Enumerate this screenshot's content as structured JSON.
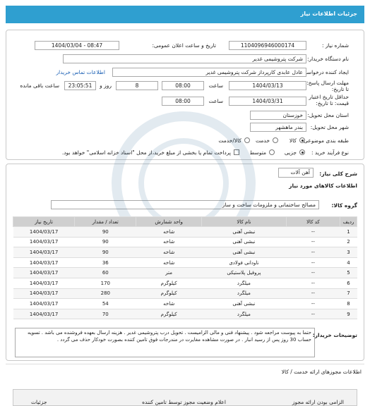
{
  "header": {
    "title": "جزئیات اطلاعات نیاز"
  },
  "form": {
    "need_number_label": "شماره نیاز :",
    "need_number_value": "1104096946000174",
    "announce_label": "تاریخ و ساعت اعلان عمومی:",
    "announce_value": "1404/03/04 - 08:47",
    "buyer_name_label": "نام دستگاه خریدار:",
    "buyer_name_value": "شرکت پتروشیمی غدیر",
    "creator_label": "ایجاد کننده درخواست:",
    "creator_value": "عادل عابدی کارپرداز شرکت پتروشیمی غدیر",
    "contact_link": "اطلاعات تماس خریدار",
    "deadline_label": "مهلت ارسال پاسخ: تا تاریخ:",
    "deadline_date": "1404/03/13",
    "time_label": "ساعت",
    "deadline_time": "08:00",
    "days_value": "8",
    "days_label": "روز و",
    "remaining_time": "23:05:51",
    "remaining_label": "ساعت باقی مانده",
    "validity_label": "حداقل تاریخ اعتبار قیمت: تا تاریخ:",
    "validity_date": "1404/03/31",
    "validity_time": "08:00",
    "province_label": "استان محل تحویل:",
    "province_value": "خوزستان",
    "city_label": "شهر محل تحویل:",
    "city_value": "بندر ماهشهر",
    "category_label": "طبقه بندی موضوعی:",
    "category_options": [
      "کالا",
      "خدمت",
      "کالا/خدمت"
    ],
    "process_label": "نوع فرآیند خرید :",
    "process_options": [
      "جزیی",
      "متوسط"
    ],
    "payment_note": "پرداخت تمام یا بخشی از مبلغ خرید،از محل \"اسناد خزانه اسلامی\" خواهد بود."
  },
  "summary": {
    "label": "شرح کلی نیاز:",
    "value": "آهن آلات",
    "goods_info_title": "اطلاعات کالاهای مورد نیاز",
    "group_label": "گروه کالا:",
    "group_value": "مصالح ساختمانی و ملزومات ساخت  و ساز"
  },
  "table": {
    "headers": [
      "ردیف",
      "کد کالا",
      "نام کالا",
      "واحد شمارش",
      "تعداد / مقدار",
      "تاریخ نیاز"
    ],
    "rows": [
      [
        "1",
        "--",
        "نبشی آهنی",
        "شاخه",
        "90",
        "1404/03/17"
      ],
      [
        "2",
        "--",
        "نبشی آهنی",
        "شاخه",
        "90",
        "1404/03/17"
      ],
      [
        "3",
        "--",
        "نبشی آهنی",
        "شاخه",
        "90",
        "1404/03/17"
      ],
      [
        "4",
        "--",
        "ناودانی فولادی",
        "شاخه",
        "36",
        "1404/03/17"
      ],
      [
        "5",
        "--",
        "پروفیل پلاستیکی",
        "متر",
        "60",
        "1404/03/17"
      ],
      [
        "6",
        "--",
        "میلگرد",
        "کیلوگرم",
        "170",
        "1404/03/17"
      ],
      [
        "7",
        "--",
        "میلگرد",
        "کیلوگرم",
        "280",
        "1404/03/17"
      ],
      [
        "8",
        "--",
        "نبشی آهنی",
        "شاخه",
        "54",
        "1404/03/17"
      ],
      [
        "9",
        "--",
        "میلگرد",
        "کیلوگرم",
        "70",
        "1404/03/17"
      ]
    ]
  },
  "notes": {
    "label": "توضیحات خریدار:",
    "text": "حتما به پیوست مراجعه شود . پیشنهاد فنی و مالی الزامیست . تحویل درب پتروشیمی غدیر . هزینه ارسال بعهده فروشنده می باشد . تسویه حساب 30 روز پس از رسید انبار . در صورت مشاهده مغایرت در مندرجات فوق تامین کننده بصورت خودکار حذف می گردد ."
  },
  "permits": {
    "title": "اطلاعات مجوزهای ارائه خدمت / کالا",
    "headers": [
      "الزامی بودن ارائه مجوز",
      "اعلام وضعیت مجوز توسط تامین کننده",
      "جزئیات"
    ]
  }
}
